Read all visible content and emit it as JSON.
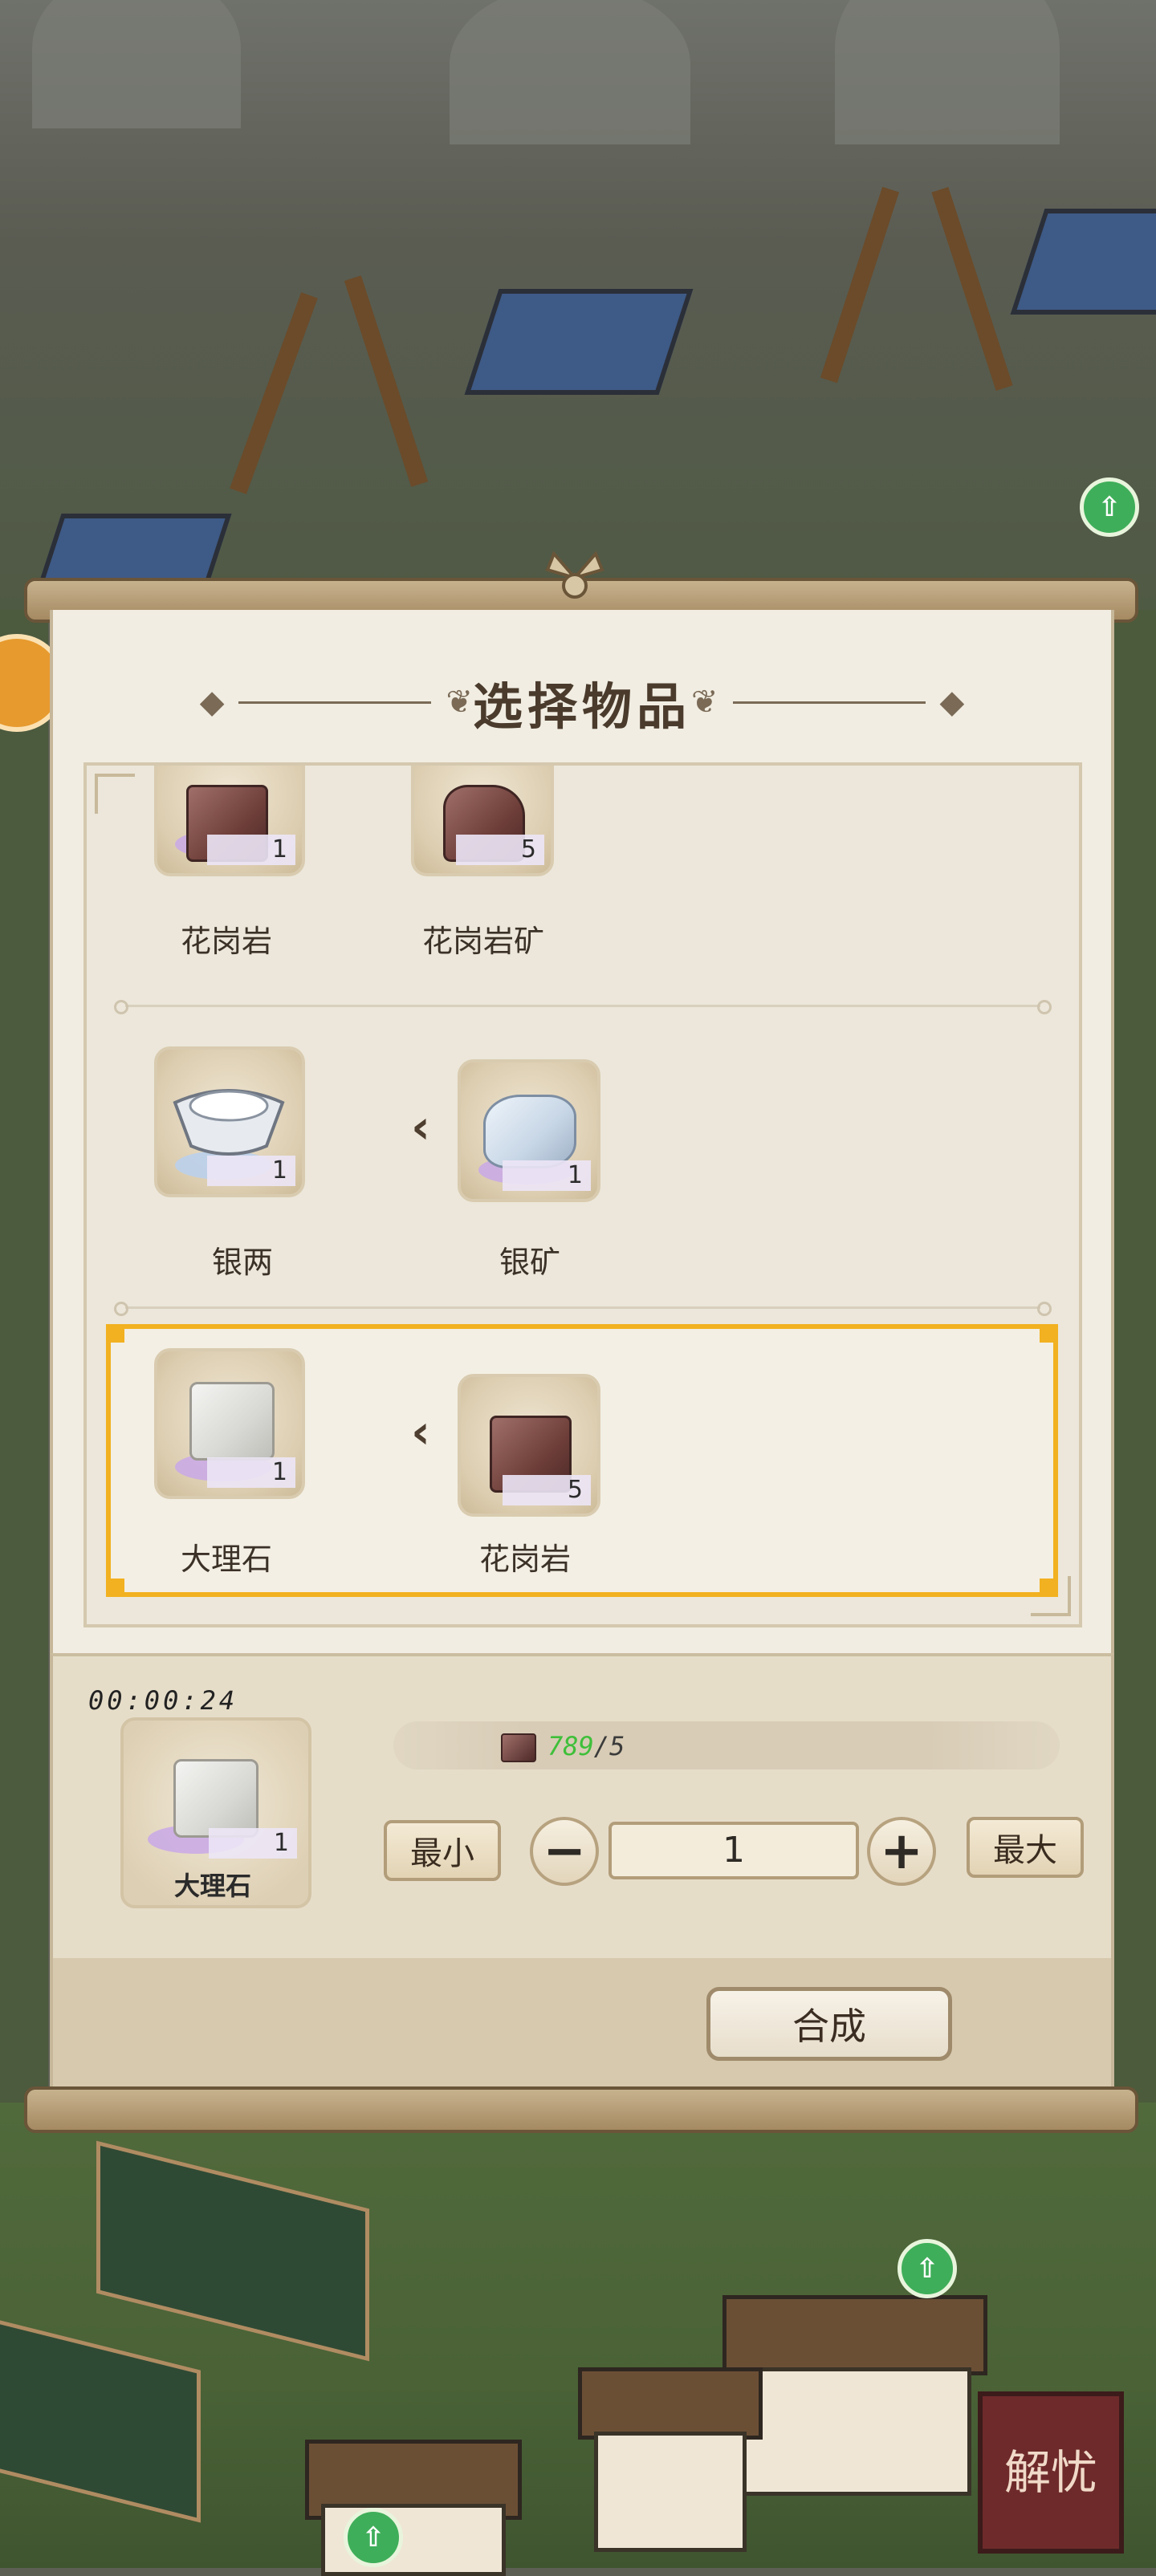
{
  "title": "选择物品",
  "recipes": [
    {
      "output": {
        "name": "花岗岩",
        "count": "1",
        "icon": "granite-icon"
      },
      "input": {
        "name": "花岗岩矿",
        "count": "5",
        "icon": "granite-ore-icon"
      }
    },
    {
      "output": {
        "name": "银两",
        "count": "1",
        "icon": "silver-ingot-icon"
      },
      "input": {
        "name": "银矿",
        "count": "1",
        "icon": "silver-ore-icon"
      }
    },
    {
      "output": {
        "name": "大理石",
        "count": "1",
        "icon": "marble-icon"
      },
      "input": {
        "name": "花岗岩",
        "count": "5",
        "icon": "granite-icon"
      },
      "selected": true
    }
  ],
  "craft": {
    "timer": "00:00:24",
    "output_name": "大理石",
    "output_count": "1",
    "requirement_have": "789",
    "requirement_need": "/5",
    "min_label": "最小",
    "max_label": "最大",
    "quantity": "1",
    "minus_label": "−",
    "plus_label": "+",
    "craft_label": "合成"
  },
  "seal_text": "解忧",
  "colors": {
    "selection": "#f2b120",
    "have_count": "#3fbf3a"
  }
}
